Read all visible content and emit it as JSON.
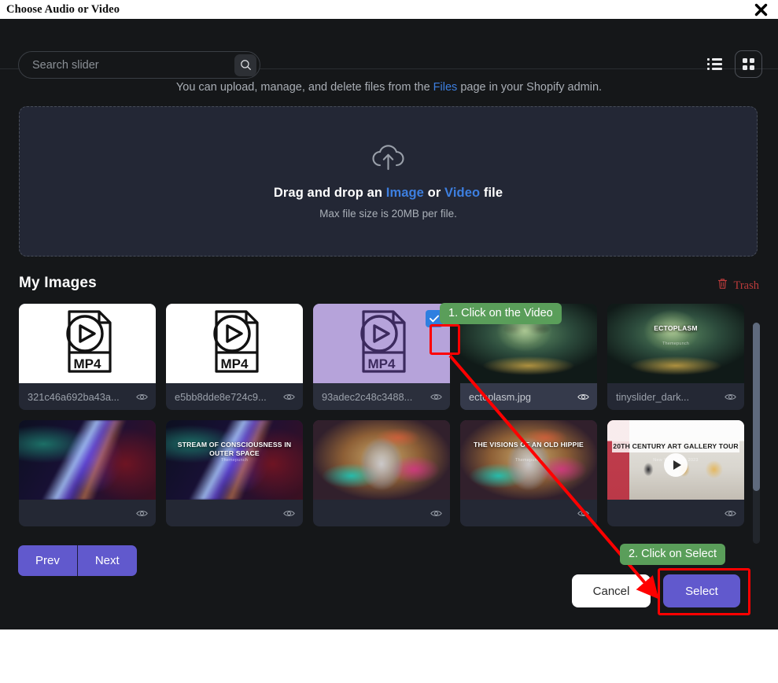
{
  "window": {
    "title": "Choose Audio or Video",
    "close_icon": "close-icon"
  },
  "search": {
    "placeholder": "Search slider",
    "value": "",
    "icon": "search-icon"
  },
  "view_toggle": {
    "list_icon": "list-view-icon",
    "grid_icon": "grid-view-icon",
    "active": "grid"
  },
  "info": {
    "prefix": "You can upload, manage, and delete files from the ",
    "link": "Files",
    "suffix": " page in your Shopify admin."
  },
  "dropzone": {
    "icon": "upload-cloud-icon",
    "main_prefix": "Drag and drop an ",
    "link_image": "Image",
    "main_middle": " or ",
    "link_video": "Video",
    "main_suffix": " file",
    "sub": "Max file size is 20MB per file."
  },
  "library": {
    "title": "My Images",
    "trash_label": "Trash",
    "trash_icon": "trash-icon",
    "files": [
      {
        "name": "321c46a692ba43a...",
        "kind": "mp4",
        "selected": false,
        "hovered": false,
        "eye_icon": "eye-icon"
      },
      {
        "name": "e5bb8dde8e724c9...",
        "kind": "mp4",
        "selected": false,
        "hovered": false,
        "eye_icon": "eye-icon"
      },
      {
        "name": "93adec2c48c3488...",
        "kind": "mp4-selected",
        "selected": true,
        "hovered": false,
        "eye_icon": "eye-icon"
      },
      {
        "name": "ectoplasm.jpg",
        "kind": "art-ecto",
        "selected": false,
        "hovered": true,
        "eye_icon": "eye-icon"
      },
      {
        "name": "tinyslider_dark...",
        "kind": "art-ecto-titled",
        "selected": false,
        "hovered": false,
        "eye_icon": "eye-icon",
        "overlay_title": "ECTOPLASM",
        "overlay_sub": "Themepunch"
      },
      {
        "name": "",
        "kind": "art-nebula",
        "selected": false,
        "hovered": false,
        "eye_icon": "eye-icon"
      },
      {
        "name": "",
        "kind": "art-nebula-titled",
        "selected": false,
        "hovered": false,
        "eye_icon": "eye-icon",
        "overlay_title": "STREAM OF CONSCIOUSNESS IN OUTER SPACE",
        "overlay_sub": "Themepunch"
      },
      {
        "name": "",
        "kind": "art-hippie",
        "selected": false,
        "hovered": false,
        "eye_icon": "eye-icon"
      },
      {
        "name": "",
        "kind": "art-hippie-titled",
        "selected": false,
        "hovered": false,
        "eye_icon": "eye-icon",
        "overlay_title": "THE VISIONS OF AN OLD HIPPIE",
        "overlay_sub": "Themepunch"
      },
      {
        "name": "",
        "kind": "art-gallery",
        "selected": false,
        "hovered": false,
        "eye_icon": "eye-icon",
        "overlay_title": "20TH CENTURY ART GALLERY TOUR",
        "overlay_sub": "New York | June 2023"
      }
    ],
    "mp4_label": "MP4"
  },
  "pager": {
    "prev": "Prev",
    "next": "Next"
  },
  "actions": {
    "cancel": "Cancel",
    "select": "Select"
  },
  "annotations": [
    {
      "text": "1. Click on the Video"
    },
    {
      "text": "2. Click on Select"
    }
  ],
  "colors": {
    "accent_purple": "#6159cd",
    "link_blue": "#3d7fe0",
    "checkbox_blue": "#2e7fe0",
    "trash_red": "#bb3b3b",
    "annotation_red": "#ff0000",
    "annotation_green": "#5a9e5a",
    "modal_bg": "#151719",
    "dropzone_bg": "#232735"
  }
}
